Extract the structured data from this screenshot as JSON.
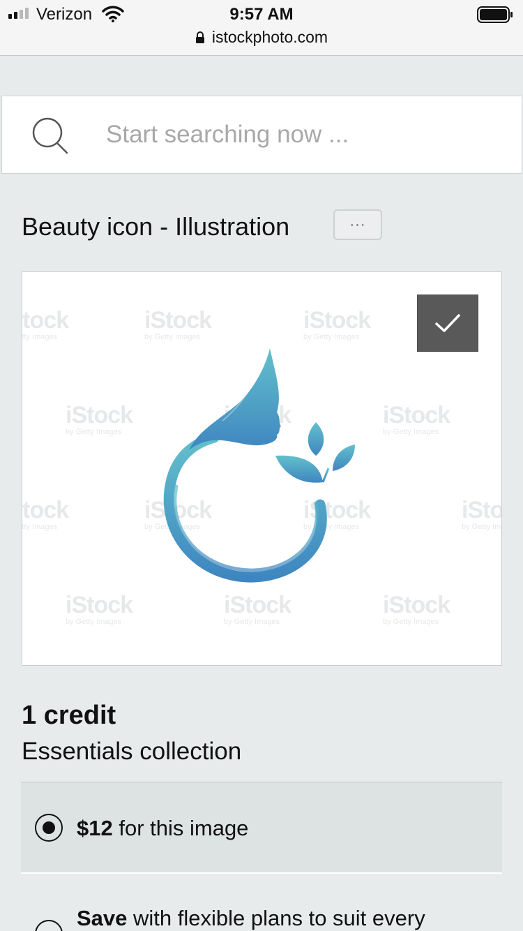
{
  "status_bar": {
    "carrier": "Verizon",
    "time": "9:57 AM",
    "url": "istockphoto.com"
  },
  "search": {
    "placeholder": "Start searching now ..."
  },
  "asset": {
    "title": "Beauty icon - Illustration",
    "more_label": "···",
    "watermark_main": "iStock",
    "watermark_sub": "by Getty Images"
  },
  "pricing": {
    "credits": "1 credit",
    "collection": "Essentials collection",
    "options": [
      {
        "bold": "$12",
        "text": " for this image",
        "selected": true
      },
      {
        "bold": "Save",
        "text": " with flexible plans to suit every",
        "selected": false
      }
    ]
  },
  "colors": {
    "illustration_top": "#63c0cc",
    "illustration_bottom": "#3f86c0",
    "background": "#e8ebec",
    "selected_row": "#dde3e3"
  }
}
